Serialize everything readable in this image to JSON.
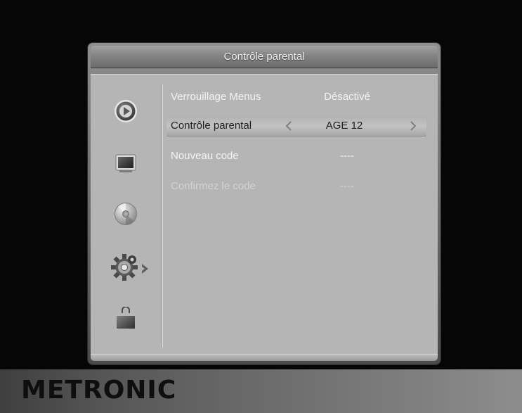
{
  "dialog": {
    "title": "Contrôle parental"
  },
  "sidebar": {
    "items": [
      {
        "icon": "play-icon"
      },
      {
        "icon": "tv-screen-icon"
      },
      {
        "icon": "disc-icon"
      },
      {
        "icon": "gear-settings-icon",
        "active": true
      },
      {
        "icon": "shopping-bag-icon"
      }
    ]
  },
  "menu": {
    "rows": [
      {
        "label": "Verrouillage Menus",
        "value": "Désactivé",
        "state": "normal"
      },
      {
        "label": "Contrôle parental",
        "value": "AGE 12",
        "state": "selected"
      },
      {
        "label": "Nouveau code",
        "value": "----",
        "state": "normal"
      },
      {
        "label": "Confirmez le code",
        "value": "----",
        "state": "disabled"
      }
    ]
  },
  "brand": {
    "name": "METRONIC"
  },
  "colors": {
    "screen_background": "#060606",
    "panel_background": "#b5b5b5",
    "title_bar": "#848484",
    "selected_row": "#c3c3c3",
    "text_light": "#f4f4f4",
    "text_dark": "#1f1f1f",
    "text_disabled": "#d3d3d3"
  }
}
